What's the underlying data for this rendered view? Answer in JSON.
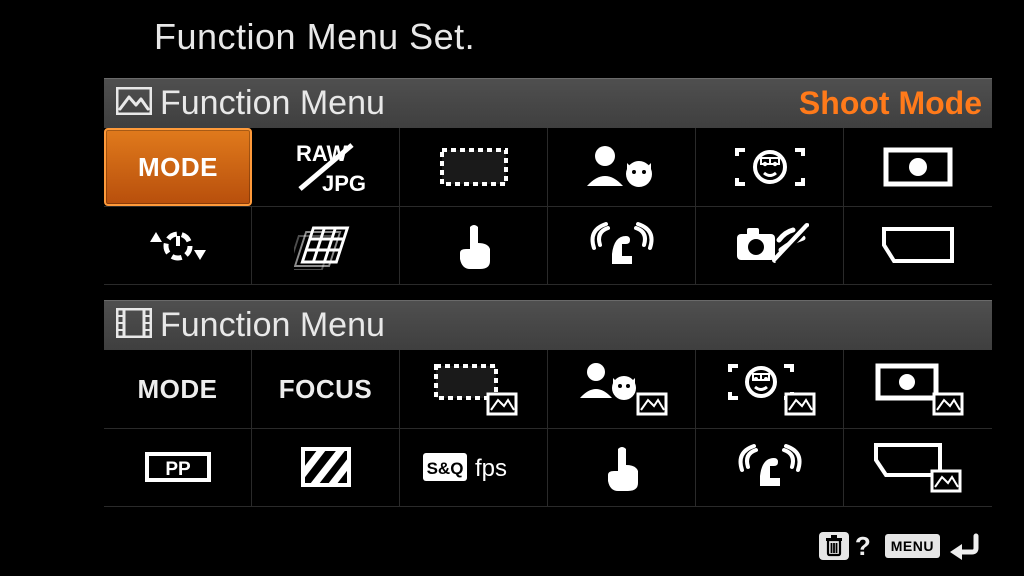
{
  "title": "Function Menu Set.",
  "hint": "Shoot Mode",
  "section1": {
    "title": "Function Menu"
  },
  "section2": {
    "title": "Function Menu"
  },
  "grid1": {
    "r0c0": "MODE"
  },
  "grid2": {
    "r0c0": "MODE",
    "r0c1": "FOCUS",
    "r1c0": "PP",
    "r1c2_prefix": "S&Q",
    "r1c2_suffix": "fps"
  },
  "footer": {
    "help": "?",
    "menu": "MENU"
  }
}
